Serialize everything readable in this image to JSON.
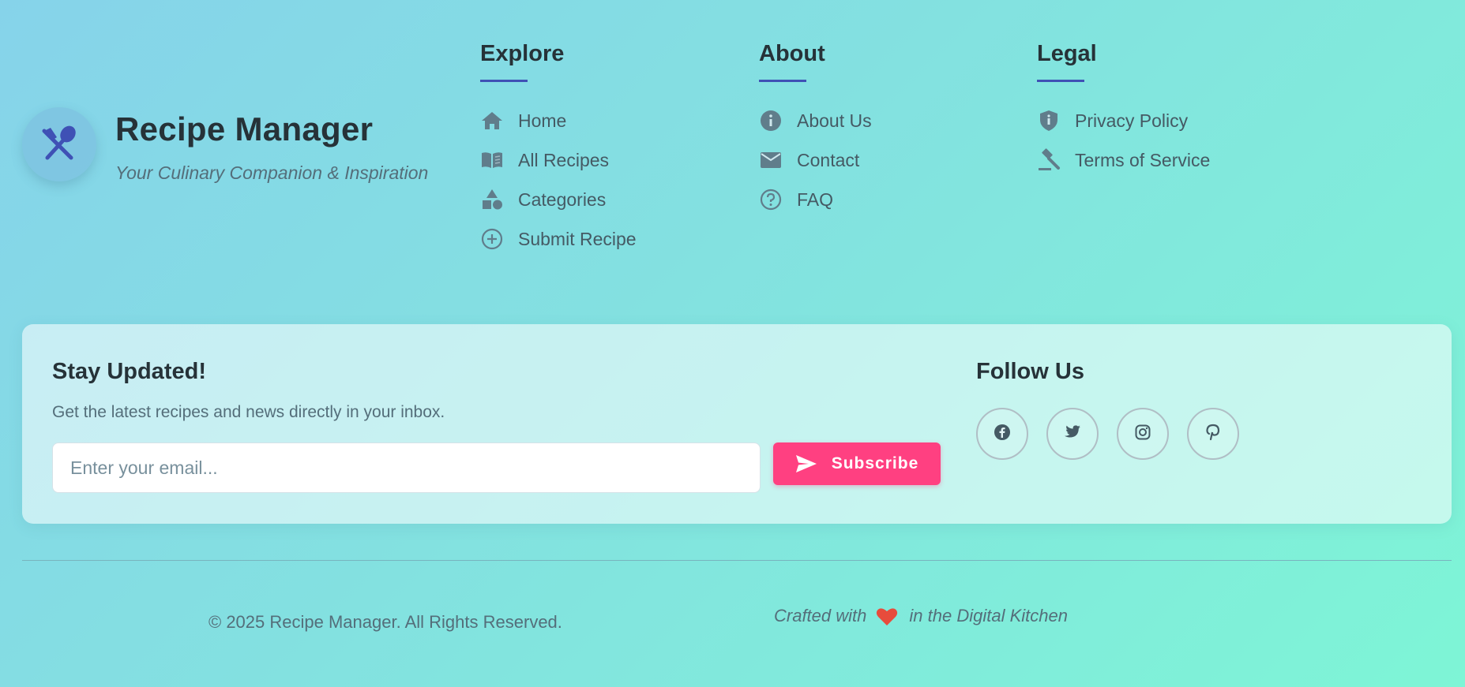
{
  "brand": {
    "title": "Recipe Manager",
    "tagline": "Your Culinary Companion & Inspiration",
    "logo_icon": "utensils-crossed-icon"
  },
  "columns": [
    {
      "heading": "Explore",
      "links": [
        {
          "label": "Home",
          "icon": "home-icon"
        },
        {
          "label": "All Recipes",
          "icon": "book-icon"
        },
        {
          "label": "Categories",
          "icon": "shapes-icon"
        },
        {
          "label": "Submit Recipe",
          "icon": "plus-circle-icon"
        }
      ]
    },
    {
      "heading": "About",
      "links": [
        {
          "label": "About Us",
          "icon": "info-icon"
        },
        {
          "label": "Contact",
          "icon": "mail-icon"
        },
        {
          "label": "FAQ",
          "icon": "help-circle-icon"
        }
      ]
    },
    {
      "heading": "Legal",
      "links": [
        {
          "label": "Privacy Policy",
          "icon": "shield-icon"
        },
        {
          "label": "Terms of Service",
          "icon": "gavel-icon"
        }
      ]
    }
  ],
  "newsletter": {
    "title": "Stay Updated!",
    "description": "Get the latest recipes and news directly in your inbox.",
    "email_placeholder": "Enter your email...",
    "email_value": "",
    "subscribe_label": "Subscribe"
  },
  "follow": {
    "title": "Follow Us",
    "networks": [
      "facebook-icon",
      "twitter-icon",
      "instagram-icon",
      "pinterest-icon"
    ]
  },
  "footer": {
    "copyright": "© 2025 Recipe Manager. All Rights Reserved.",
    "crafted_prefix": "Crafted with",
    "crafted_suffix": "in the Digital Kitchen"
  },
  "colors": {
    "accent": "#3f51b5",
    "subscribe": "#ff4081",
    "heart": "#e74c3c",
    "icon": "#607d8b"
  }
}
